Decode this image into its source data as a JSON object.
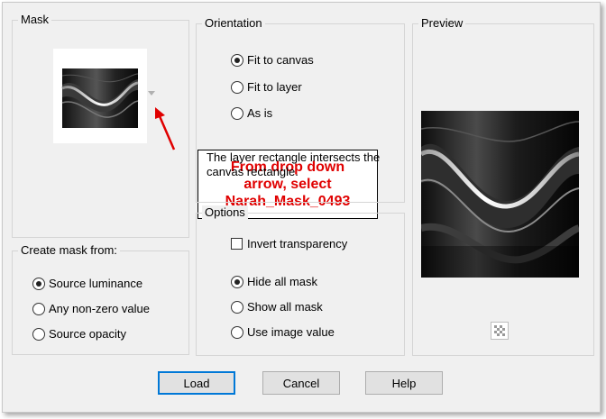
{
  "mask": {
    "legend": "Mask",
    "callout_lines": [
      "From drop down",
      "arrow, select",
      "Narah_Mask_0493"
    ]
  },
  "create_from": {
    "legend": "Create mask from:",
    "options": [
      {
        "label": "Source luminance",
        "selected": true
      },
      {
        "label": "Any non-zero value",
        "selected": false
      },
      {
        "label": "Source opacity",
        "selected": false
      }
    ]
  },
  "orientation": {
    "legend": "Orientation",
    "options": [
      {
        "label": "Fit to canvas",
        "selected": true
      },
      {
        "label": "Fit to layer",
        "selected": false
      },
      {
        "label": "As is",
        "selected": false
      }
    ],
    "note": "The layer rectangle intersects the canvas rectangle."
  },
  "options": {
    "legend": "Options",
    "invert_label": "Invert transparency",
    "invert_checked": false,
    "mask_options": [
      {
        "label": "Hide all mask",
        "selected": true
      },
      {
        "label": "Show all mask",
        "selected": false
      },
      {
        "label": "Use image value",
        "selected": false
      }
    ]
  },
  "preview": {
    "legend": "Preview"
  },
  "buttons": {
    "load": "Load",
    "cancel": "Cancel",
    "help": "Help"
  },
  "colors": {
    "callout_text": "#e00000",
    "arrow": "#e00000",
    "default_button_border": "#0078d7"
  },
  "icons": {
    "dropdown": "triangle-down-icon",
    "transparency": "checkerboard-icon"
  }
}
